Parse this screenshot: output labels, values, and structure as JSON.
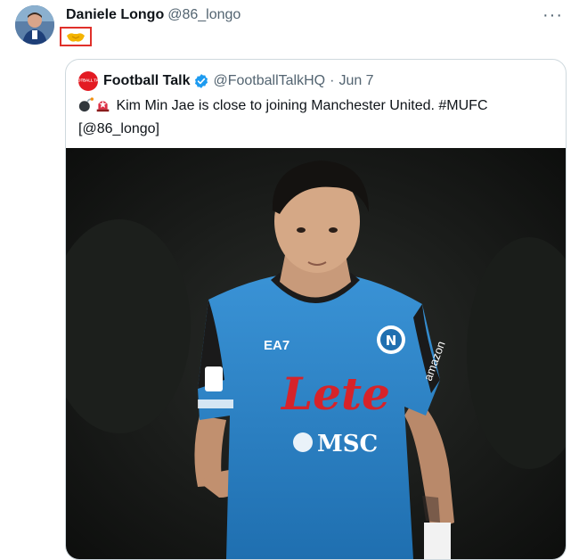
{
  "tweet": {
    "author_name": "Daniele Longo",
    "author_handle": "@86_longo",
    "more_label": "···",
    "reply_emoji": "handshake-emoji"
  },
  "quoted": {
    "logo_text": "FOOTBALL TALK",
    "author_name": "Football Talk",
    "author_handle": "@FootballTalkHQ",
    "separator": "·",
    "date": "Jun 7",
    "text_line1": "Kim Min Jae is close to joining Manchester United. #MUFC",
    "text_line2": "[@86_longo]",
    "emoji_1": "bomb-emoji",
    "emoji_2": "rotating-light-emoji"
  },
  "photo": {
    "kit_sponsor": "Lete",
    "kit_secondary_sponsor": "MSC",
    "kit_brand": "EA7",
    "club_crest": "N",
    "sleeve_text": "amazon"
  },
  "colors": {
    "verified": "#1d9bf0",
    "kit_blue": "#2f86c9",
    "sponsor_red": "#d6232a"
  }
}
